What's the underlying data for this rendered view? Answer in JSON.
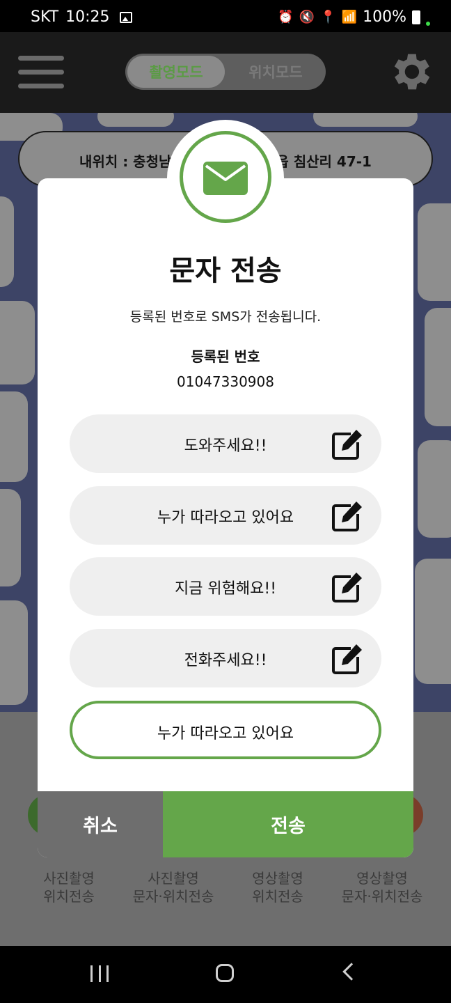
{
  "status_bar": {
    "carrier": "SKT",
    "time": "10:25",
    "battery": "100%"
  },
  "header": {
    "mode_active": "촬영모드",
    "mode_inactive": "위치모드"
  },
  "location": {
    "prefix": "내위치 : 충청남",
    "suffix": "읍 침산리 47-1"
  },
  "bottom_captions": [
    "사진촬영\n위치전송",
    "사진촬영\n문자·위치전송",
    "영상촬영\n위치전송",
    "영상촬영\n문자·위치전송"
  ],
  "dialog": {
    "title": "문자 전송",
    "description": "등록된 번호로 SMS가 전송됩니다.",
    "number_label": "등록된 번호",
    "number": "01047330908",
    "messages": [
      "도와주세요!!",
      "누가 따라오고 있어요",
      "지금 위험해요!!",
      "전화주세요!!"
    ],
    "selected_message": "누가 따라오고 있어요",
    "cancel_label": "취소",
    "send_label": "전송"
  },
  "colors": {
    "accent": "#64a64a",
    "cancel": "#6e6e6e"
  }
}
